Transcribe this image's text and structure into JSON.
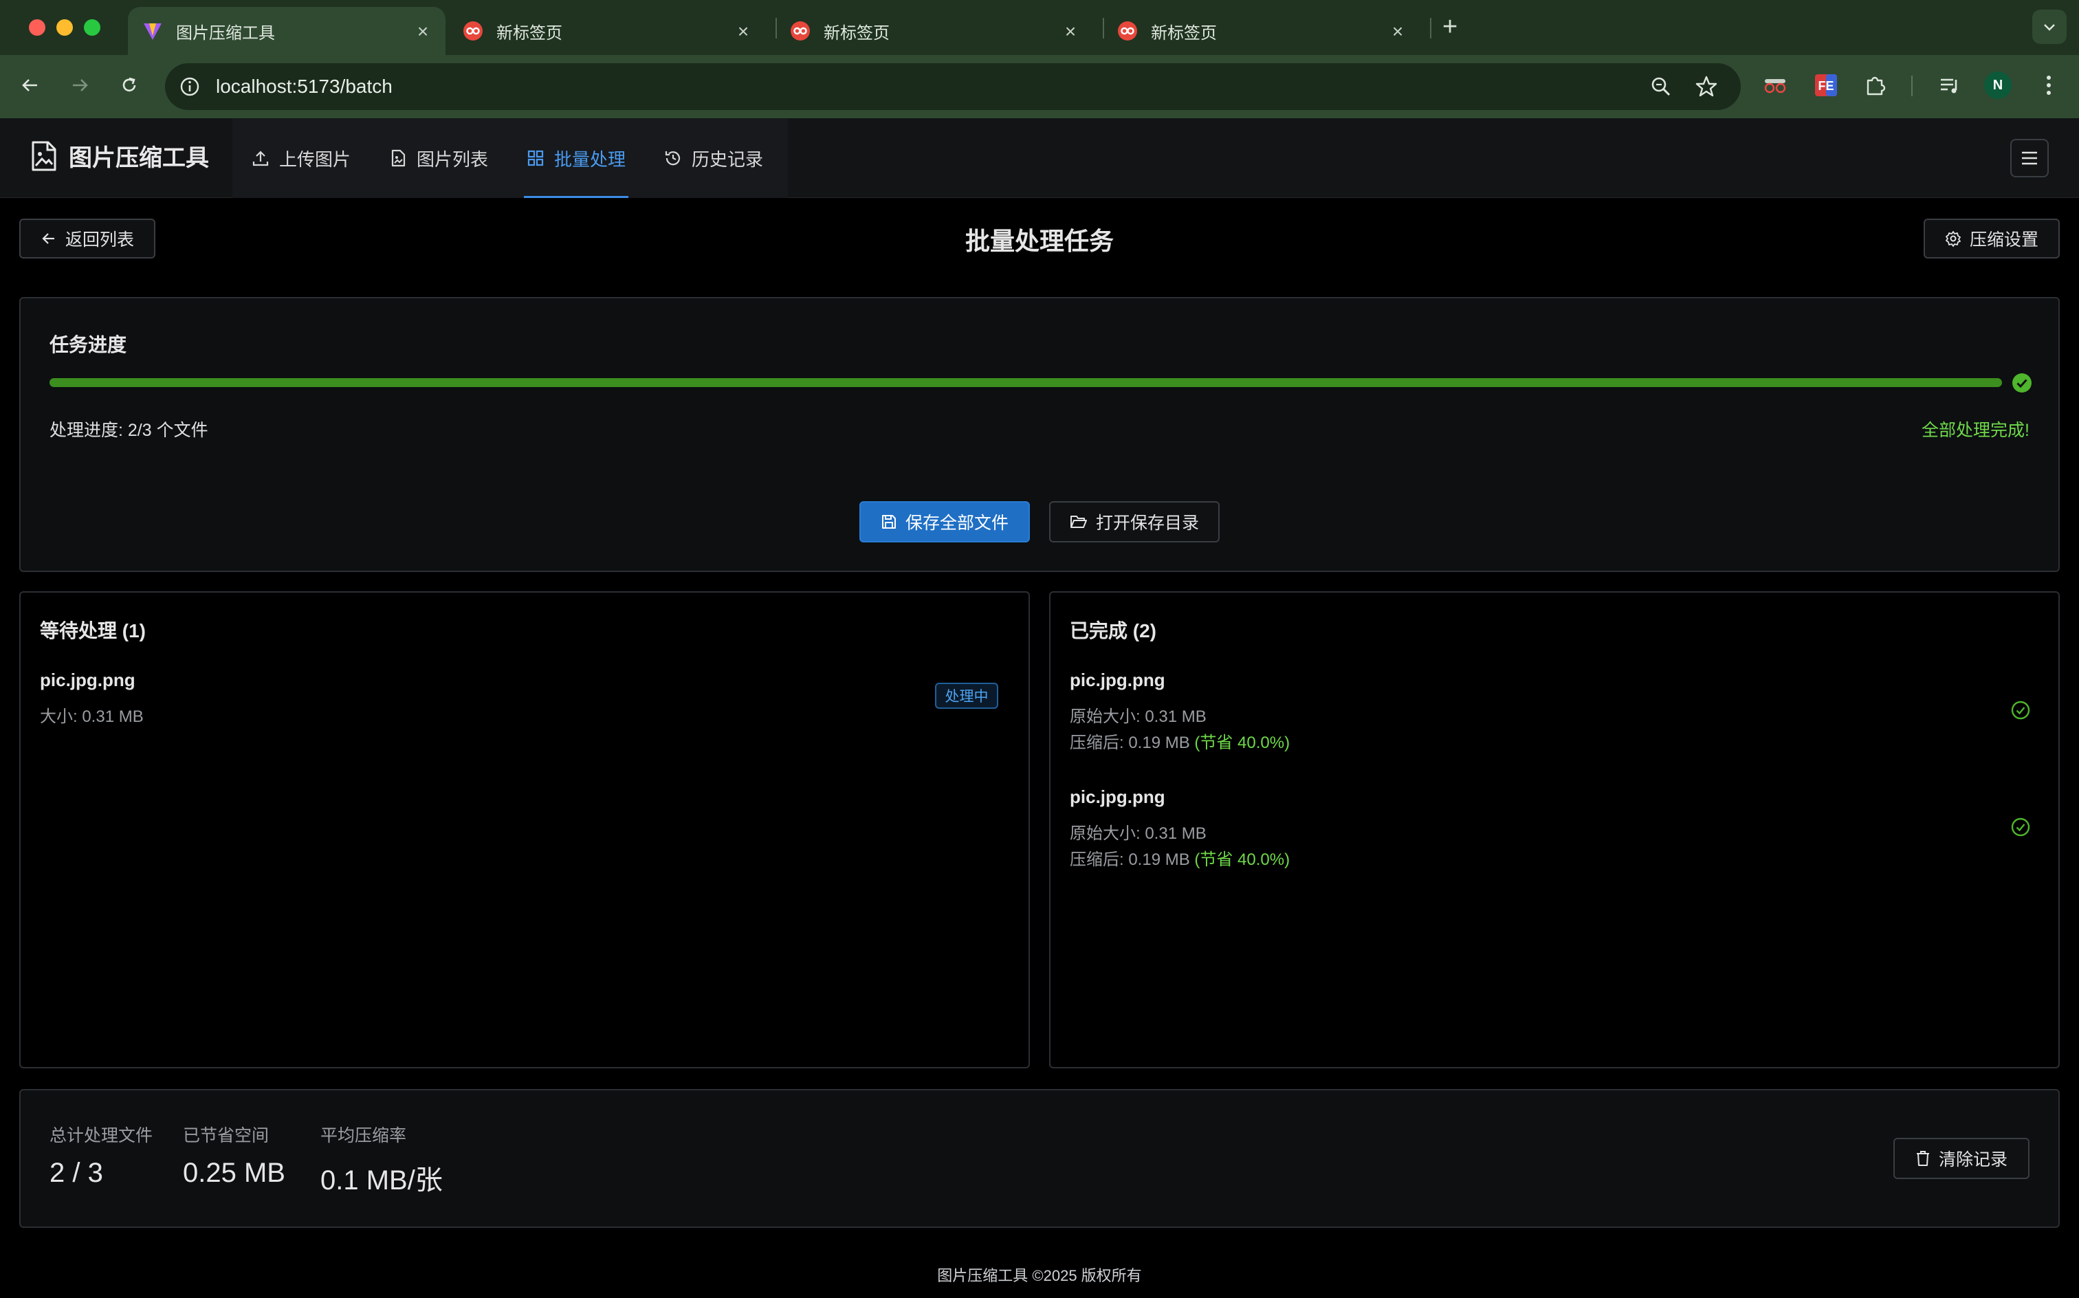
{
  "browser": {
    "tabs": [
      {
        "title": "图片压缩工具",
        "active": true
      },
      {
        "title": "新标签页",
        "active": false
      },
      {
        "title": "新标签页",
        "active": false
      },
      {
        "title": "新标签页",
        "active": false
      }
    ],
    "url": "localhost:5173/batch",
    "profile_initial": "N"
  },
  "app": {
    "brand": "图片压缩工具",
    "nav": [
      {
        "label": "上传图片",
        "icon": "upload-icon"
      },
      {
        "label": "图片列表",
        "icon": "file-image-icon"
      },
      {
        "label": "批量处理",
        "icon": "grid-icon"
      },
      {
        "label": "历史记录",
        "icon": "history-icon"
      }
    ],
    "active_nav": "批量处理"
  },
  "page": {
    "back_label": "返回列表",
    "title": "批量处理任务",
    "settings_label": "压缩设置"
  },
  "progress": {
    "title": "任务进度",
    "fraction": 1.0,
    "status_text": "处理进度: 2/3 个文件",
    "complete_text": "全部处理完成!",
    "save_all_label": "保存全部文件",
    "open_dir_label": "打开保存目录"
  },
  "pending": {
    "title": "等待处理 (1)",
    "items": [
      {
        "name": "pic.jpg.png",
        "size": "大小: 0.31 MB",
        "badge": "处理中"
      }
    ]
  },
  "completed": {
    "title": "已完成 (2)",
    "items": [
      {
        "name": "pic.jpg.png",
        "original": "原始大小: 0.31 MB",
        "compressed": "压缩后: 0.19 MB",
        "saving": "(节省 40.0%)"
      },
      {
        "name": "pic.jpg.png",
        "original": "原始大小: 0.31 MB",
        "compressed": "压缩后: 0.19 MB",
        "saving": "(节省 40.0%)"
      }
    ]
  },
  "stats": {
    "total_label": "总计处理文件",
    "total_value": "2 / 3",
    "saved_label": "已节省空间",
    "saved_value": "0.25 MB",
    "avg_label": "平均压缩率",
    "avg_value": "0.1 MB/张",
    "clear_label": "清除记录"
  },
  "footer": "图片压缩工具 ©2025 版权所有",
  "colors": {
    "accent": "#3d8ce8",
    "success": "#6fd94a",
    "progress": "#3c8e1e",
    "chrome": "#1f3320"
  }
}
